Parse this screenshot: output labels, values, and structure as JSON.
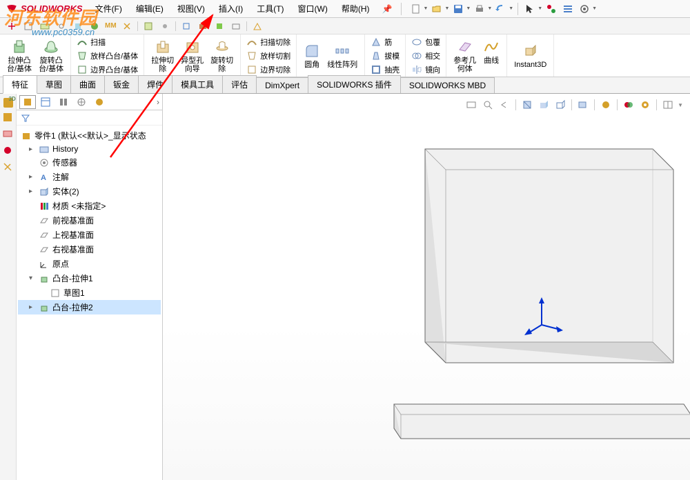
{
  "app": {
    "name": "SOLIDWORKS"
  },
  "watermark": {
    "text": "河东软件园",
    "url": "www.pc0359.cn"
  },
  "menu": {
    "file": "文件(F)",
    "edit": "编辑(E)",
    "view": "视图(V)",
    "insert": "插入(I)",
    "tools": "工具(T)",
    "window": "窗口(W)",
    "help": "帮助(H)"
  },
  "ribbon": {
    "extrude": "拉伸凸\n台/基体",
    "revolve": "旋转凸\n台/基体",
    "sweep": "扫描",
    "loft": "放样凸台/基体",
    "boundary": "边界凸台/基体",
    "extrudeCut": "拉伸切\n除",
    "holeWizard": "异型孔\n向导",
    "revolveCut": "旋转切\n除",
    "sweepCut": "扫描切除",
    "loftCut": "放样切割",
    "boundaryCut": "边界切除",
    "fillet": "圆角",
    "linearPattern": "线性阵列",
    "rib": "筋",
    "draft": "拔模",
    "shell": "抽壳",
    "wrap": "包覆",
    "intersect": "相交",
    "mirror": "镜向",
    "refGeom": "参考几\n何体",
    "curves": "曲线",
    "instant3d": "Instant3D"
  },
  "tabs": {
    "features": "特征",
    "sketch": "草图",
    "surfaces": "曲面",
    "sheetMetal": "钣金",
    "weldments": "焊件",
    "moldTools": "模具工具",
    "evaluate": "评估",
    "dimxpert": "DimXpert",
    "swaddins": "SOLIDWORKS 插件",
    "swmbd": "SOLIDWORKS MBD"
  },
  "tree": {
    "part": "零件1  (默认<<默认>_显示状态",
    "history": "History",
    "sensors": "传感器",
    "annotations": "注解",
    "solids": "实体(2)",
    "material": "材质 <未指定>",
    "front": "前视基准面",
    "top": "上视基准面",
    "right": "右视基准面",
    "origin": "原点",
    "extrude1": "凸台-拉伸1",
    "sketch1": "草图1",
    "extrude2": "凸台-拉伸2"
  }
}
